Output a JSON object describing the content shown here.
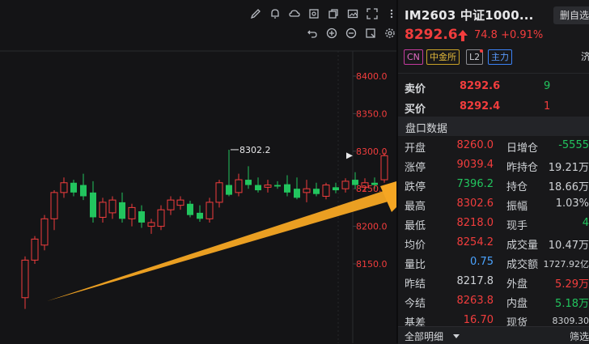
{
  "chart": {
    "y_ticks": [
      "8400.0",
      "8350.0",
      "8300.0",
      "8250.0",
      "8200.0",
      "8150.0"
    ],
    "high_marker": "8302.2",
    "candles": [
      {
        "o": 8105,
        "h": 8160,
        "l": 8090,
        "c": 8155
      },
      {
        "o": 8155,
        "h": 8187,
        "l": 8150,
        "c": 8183
      },
      {
        "o": 8175,
        "h": 8215,
        "l": 8168,
        "c": 8210
      },
      {
        "o": 8210,
        "h": 8248,
        "l": 8195,
        "c": 8245
      },
      {
        "o": 8245,
        "h": 8265,
        "l": 8238,
        "c": 8258
      },
      {
        "o": 8258,
        "h": 8262,
        "l": 8240,
        "c": 8245
      },
      {
        "o": 8255,
        "h": 8270,
        "l": 8235,
        "c": 8240
      },
      {
        "o": 8245,
        "h": 8260,
        "l": 8205,
        "c": 8212
      },
      {
        "o": 8212,
        "h": 8238,
        "l": 8205,
        "c": 8232
      },
      {
        "o": 8218,
        "h": 8240,
        "l": 8210,
        "c": 8235
      },
      {
        "o": 8232,
        "h": 8245,
        "l": 8205,
        "c": 8210
      },
      {
        "o": 8210,
        "h": 8230,
        "l": 8200,
        "c": 8225
      },
      {
        "o": 8220,
        "h": 8228,
        "l": 8198,
        "c": 8205
      },
      {
        "o": 8200,
        "h": 8210,
        "l": 8190,
        "c": 8205
      },
      {
        "o": 8200,
        "h": 8228,
        "l": 8195,
        "c": 8222
      },
      {
        "o": 8222,
        "h": 8240,
        "l": 8215,
        "c": 8235
      },
      {
        "o": 8228,
        "h": 8240,
        "l": 8222,
        "c": 8235
      },
      {
        "o": 8230,
        "h": 8234,
        "l": 8212,
        "c": 8215
      },
      {
        "o": 8218,
        "h": 8228,
        "l": 8206,
        "c": 8210
      },
      {
        "o": 8210,
        "h": 8238,
        "l": 8205,
        "c": 8232
      },
      {
        "o": 8232,
        "h": 8262,
        "l": 8225,
        "c": 8258
      },
      {
        "o": 8255,
        "h": 8302,
        "l": 8240,
        "c": 8242
      },
      {
        "o": 8245,
        "h": 8270,
        "l": 8240,
        "c": 8262
      },
      {
        "o": 8262,
        "h": 8280,
        "l": 8250,
        "c": 8255
      },
      {
        "o": 8255,
        "h": 8265,
        "l": 8245,
        "c": 8248
      },
      {
        "o": 8252,
        "h": 8262,
        "l": 8245,
        "c": 8255
      },
      {
        "o": 8255,
        "h": 8260,
        "l": 8250,
        "c": 8253
      },
      {
        "o": 8256,
        "h": 8268,
        "l": 8240,
        "c": 8245
      },
      {
        "o": 8250,
        "h": 8265,
        "l": 8236,
        "c": 8238
      },
      {
        "o": 8245,
        "h": 8262,
        "l": 8232,
        "c": 8250
      },
      {
        "o": 8250,
        "h": 8258,
        "l": 8240,
        "c": 8243
      },
      {
        "o": 8240,
        "h": 8258,
        "l": 8236,
        "c": 8255
      },
      {
        "o": 8252,
        "h": 8258,
        "l": 8244,
        "c": 8248
      },
      {
        "o": 8250,
        "h": 8264,
        "l": 8245,
        "c": 8260
      },
      {
        "o": 8262,
        "h": 8272,
        "l": 8250,
        "c": 8255
      },
      {
        "o": 8252,
        "h": 8264,
        "l": 8246,
        "c": 8258
      },
      {
        "o": 8258,
        "h": 8265,
        "l": 8250,
        "c": 8255
      },
      {
        "o": 8262,
        "h": 8298,
        "l": 8258,
        "c": 8294
      }
    ]
  },
  "panel": {
    "title": "IM2603 中证1000...",
    "watch_button": "删自选",
    "price": "8292.6",
    "change": "74.8 +0.91%",
    "tags": {
      "cn": "CN",
      "exchange": "中金所",
      "l2": "L2",
      "main": "主力",
      "right": "济"
    },
    "orderbook": [
      {
        "label": "卖价",
        "price": "8292.6",
        "vol": "9"
      },
      {
        "label": "买价",
        "price": "8292.4",
        "vol": "1"
      }
    ],
    "section_title": "盘口数据",
    "rows": [
      {
        "l1": "开盘",
        "v1": "8260.0",
        "l2": "日增仓",
        "v2": "-5555"
      },
      {
        "l1": "涨停",
        "v1": "9039.4",
        "l2": "昨持仓",
        "v2": "19.21万"
      },
      {
        "l1": "跌停",
        "v1": "7396.2",
        "l2": "持仓",
        "v2": "18.66万"
      },
      {
        "l1": "最高",
        "v1": "8302.6",
        "l2": "振幅",
        "v2": "1.03%"
      },
      {
        "l1": "最低",
        "v1": "8218.0",
        "l2": "现手",
        "v2": "4"
      },
      {
        "l1": "均价",
        "v1": "8254.2",
        "l2": "成交量",
        "v2": "10.47万"
      },
      {
        "l1": "量比",
        "v1": "0.75",
        "l2": "成交额",
        "v2": "1727.92亿"
      },
      {
        "l1": "昨结",
        "v1": "8217.8",
        "l2": "外盘",
        "v2": "5.29万"
      },
      {
        "l1": "今结",
        "v1": "8263.8",
        "l2": "内盘",
        "v2": "5.18万"
      },
      {
        "l1": "基差",
        "v1": "16.70",
        "l2": "现货",
        "v2": "8309.30"
      }
    ],
    "footer_left": "全部明细",
    "footer_right": "筛选"
  },
  "colors": {
    "up": "#f23d3d",
    "down": "#22c55e",
    "arrow": "#f5a623"
  }
}
